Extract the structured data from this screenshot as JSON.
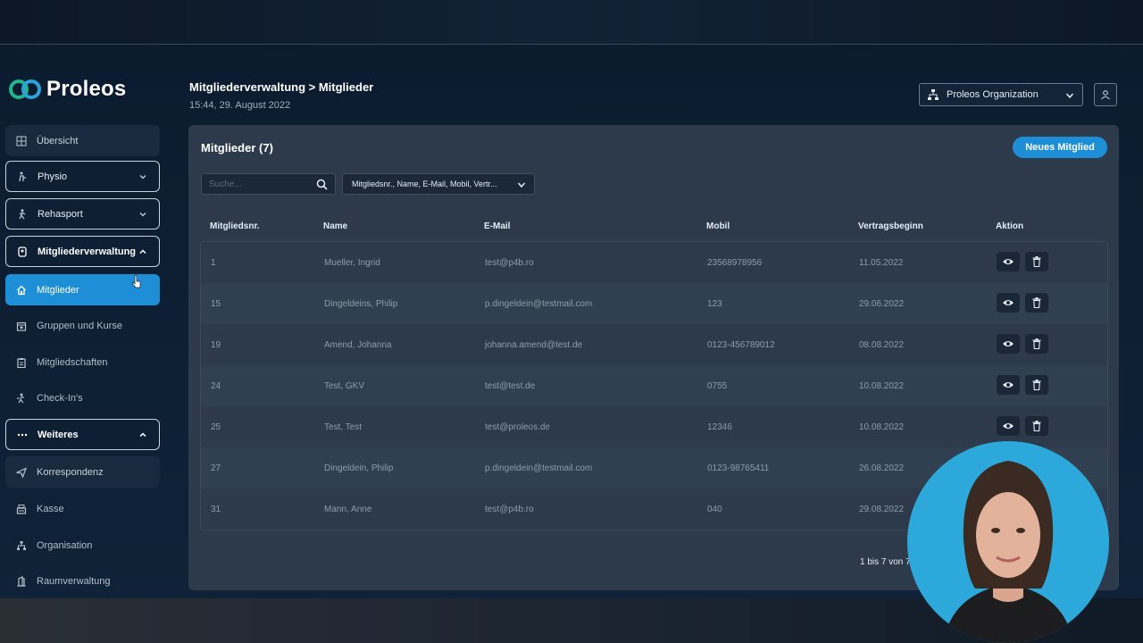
{
  "brand": {
    "name": "Proleos"
  },
  "sidebar": {
    "items": [
      {
        "label": "Übersicht",
        "icon": "grid-icon"
      },
      {
        "label": "Physio",
        "icon": "physio-icon"
      },
      {
        "label": "Rehasport",
        "icon": "walking-icon"
      },
      {
        "label": "Mitgliederverwaltung",
        "icon": "badge-icon"
      },
      {
        "label": "Mitglieder",
        "icon": "home-icon"
      },
      {
        "label": "Gruppen und Kurse",
        "icon": "calendar-icon"
      },
      {
        "label": "Mitgliedschaften",
        "icon": "clipboard-icon"
      },
      {
        "label": "Check-In's",
        "icon": "checkin-icon"
      },
      {
        "label": "Weiteres",
        "icon": "more-icon"
      },
      {
        "label": "Korrespondenz",
        "icon": "send-icon"
      },
      {
        "label": "Kasse",
        "icon": "register-icon"
      },
      {
        "label": "Organisation",
        "icon": "org-icon"
      },
      {
        "label": "Raumverwaltung",
        "icon": "room-icon"
      }
    ]
  },
  "header": {
    "breadcrumb": "Mitgliederverwaltung > Mitglieder",
    "datetime": "15:44, 29. August 2022",
    "organization": "Proleos Organization"
  },
  "panel": {
    "title": "Mitglieder (7)",
    "new_button": "Neues Mitglied",
    "search_placeholder": "Suche...",
    "filter_label": "Mitgliedsnr., Name, E-Mail, Mobil, Vertr...",
    "columns": [
      "Mitgliedsnr.",
      "Name",
      "E-Mail",
      "Mobil",
      "Vertragsbeginn",
      "Aktion"
    ],
    "rows": [
      {
        "nr": "1",
        "name": "Mueller, Ingrid",
        "email": "test@p4b.ro",
        "mobil": "23568978956",
        "start": "11.05.2022"
      },
      {
        "nr": "15",
        "name": "Dingeldeins, Philip",
        "email": "p.dingeldein@testmail.com",
        "mobil": "123",
        "start": "29.06.2022"
      },
      {
        "nr": "19",
        "name": "Amend, Johanna",
        "email": "johanna.amend@test.de",
        "mobil": "0123-456789012",
        "start": "08.08.2022"
      },
      {
        "nr": "24",
        "name": "Test, GKV",
        "email": "test@test.de",
        "mobil": "0755",
        "start": "10.08.2022"
      },
      {
        "nr": "25",
        "name": "Test, Test",
        "email": "test@proleos.de",
        "mobil": "12346",
        "start": "10.08.2022"
      },
      {
        "nr": "27",
        "name": "Dingeldein, Philip",
        "email": "p.dingeldein@testmail.com",
        "mobil": "0123-98765411",
        "start": "26.08.2022"
      },
      {
        "nr": "31",
        "name": "Mann, Anne",
        "email": "test@p4b.ro",
        "mobil": "040",
        "start": "29.08.2022"
      }
    ],
    "pagination": "1 bis 7 von 7"
  },
  "colors": {
    "accent": "#1e8fd6",
    "panel": "#2c3a4b",
    "background": "#0f2237"
  }
}
